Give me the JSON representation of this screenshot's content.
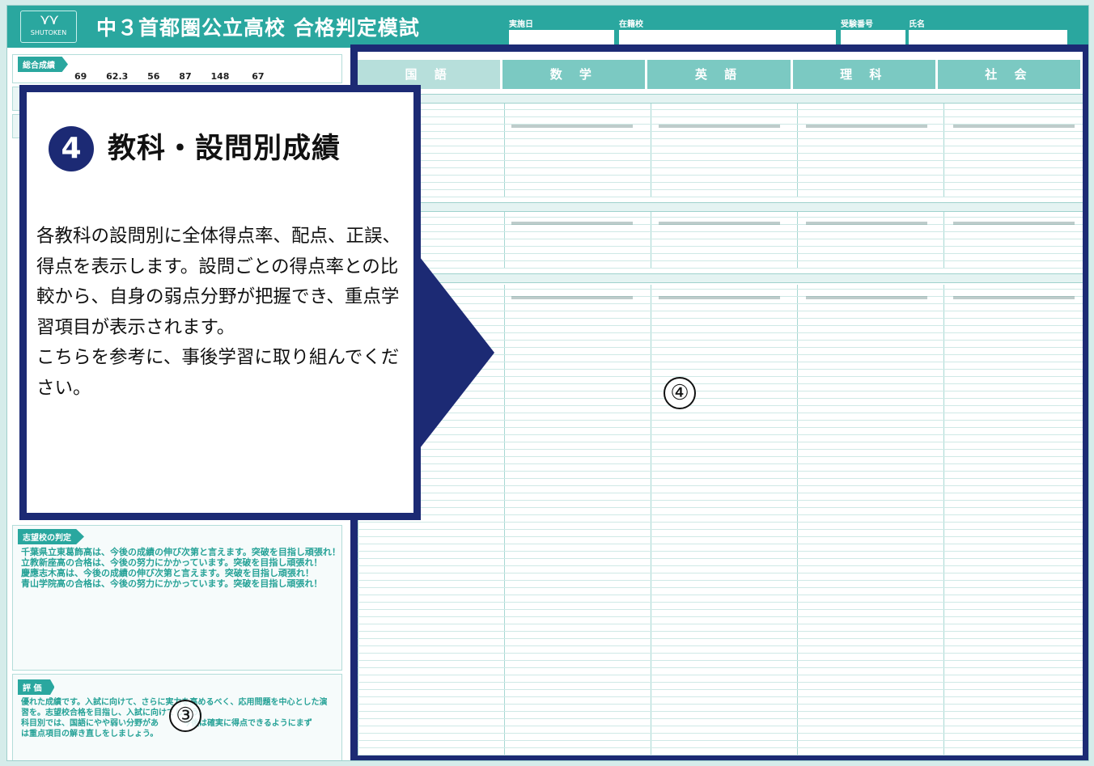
{
  "header": {
    "logo_text": "SHUTOKEN",
    "title": "中３首都圏公立高校 合格判定模試",
    "fields": [
      "実施日",
      "在籍校",
      "受験番号",
      "氏名"
    ]
  },
  "left_panel": {
    "scores_tag": "総合成績",
    "score_values": [
      "69",
      "62.3",
      "56",
      "87",
      "148",
      "67"
    ],
    "outlook_tag": "志望校の判定",
    "outlook_lines": [
      "千葉県立東葛飾高は、今後の成績の伸び次第と言えます。突破を目指し頑張れ！",
      "立教新座高の合格は、今後の努力にかかっています。突破を目指し頑張れ！",
      "慶應志木高は、今後の成績の伸び次第と言えます。突破を目指し頑張れ！",
      "青山学院高の合格は、今後の努力にかかっています。突破を目指し頑張れ！"
    ],
    "eval_tag": "評 価",
    "eval_lines": [
      "優れた成績です。入試に向けて、さらに実力を高めるべく、応用問題を中心とした演",
      "習を。志望校合格を目指し、入試に向けてしよう。",
      "科目別では、国語にやや弱い分野があ　　　今後は確実に得点できるようにまず",
      "は重点項目の解き直しをしましょう。"
    ],
    "marker": "③"
  },
  "sheet": {
    "subjects": [
      "国 語",
      "数 学",
      "英 語",
      "理 科",
      "社 会"
    ],
    "marker": "④"
  },
  "callout": {
    "badge": "4",
    "heading": "教科・設問別成績",
    "paragraph1": "各教科の設問別に全体得点率、配点、正誤、得点を表示します。設問ごとの得点率との比較から、自身の弱点分野が把握でき、重点学習項目が表示されます。",
    "paragraph2": "こちらを参考に、事後学習に取り組んでください。"
  },
  "colors": {
    "teal": "#2aa79f",
    "navy": "#1c2a74",
    "background": "#d5ecea"
  }
}
